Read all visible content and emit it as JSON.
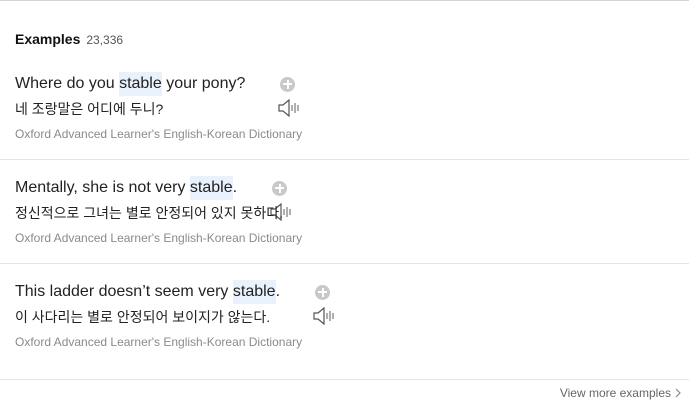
{
  "examples_header": {
    "title": "Examples",
    "count": "23,336"
  },
  "examples": [
    {
      "parts": [
        "Where do you ",
        "stable",
        " your pony?"
      ],
      "translation": "네 조랑말은 어디에 두니?",
      "source": "Oxford Advanced Learner's English-Korean Dictionary"
    },
    {
      "parts": [
        "Mentally, she is not very ",
        "stable",
        "."
      ],
      "translation": "정신적으로 그녀는 별로 안정되어 있지 못하다.",
      "source": "Oxford Advanced Learner's English-Korean Dictionary"
    },
    {
      "parts": [
        "This ladder doesn’t seem very ",
        "stable",
        "."
      ],
      "translation": "이 사다리는 별로 안정되어 보이지가 않는다.",
      "source": "Oxford Advanced Learner's English-Korean Dictionary"
    }
  ],
  "footer": {
    "view_more": "View more examples"
  },
  "icons": {
    "speaker": "speaker-icon",
    "add": "plus-circle-icon",
    "chevron": "chevron-right-icon"
  },
  "colors": {
    "highlight": "#e8f1fc",
    "separator": "#e6e6e6"
  }
}
